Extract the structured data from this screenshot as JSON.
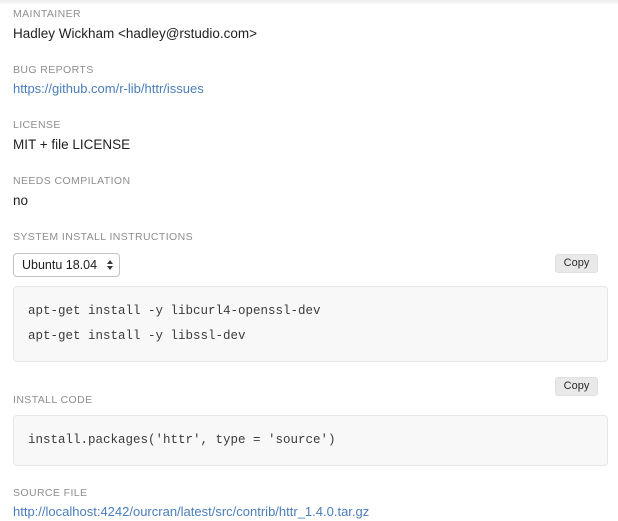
{
  "fields": {
    "maintainer": {
      "label": "MAINTAINER",
      "value": "Hadley Wickham <hadley@rstudio.com>"
    },
    "bug_reports": {
      "label": "BUG REPORTS",
      "value": "https://github.com/r-lib/httr/issues"
    },
    "license": {
      "label": "LICENSE",
      "value": "MIT + file LICENSE"
    },
    "needs_compilation": {
      "label": "NEEDS COMPILATION",
      "value": "no"
    },
    "system_install": {
      "label": "SYSTEM INSTALL INSTRUCTIONS",
      "os_selected": "Ubuntu 18.04",
      "copy_label": "Copy",
      "code_lines": [
        "apt-get install -y libcurl4-openssl-dev",
        "apt-get install -y libssl-dev"
      ]
    },
    "install_code": {
      "label": "INSTALL CODE",
      "copy_label": "Copy",
      "code_lines": [
        "install.packages('httr', type = 'source')"
      ]
    },
    "source_file": {
      "label": "SOURCE FILE",
      "value": "http://localhost:4242/ourcran/latest/src/contrib/httr_1.4.0.tar.gz"
    }
  },
  "colors": {
    "link": "#4a7ebb",
    "label": "#8e8e8e",
    "code_bg": "#f8f8f8",
    "button_bg": "#e9e9e9"
  }
}
